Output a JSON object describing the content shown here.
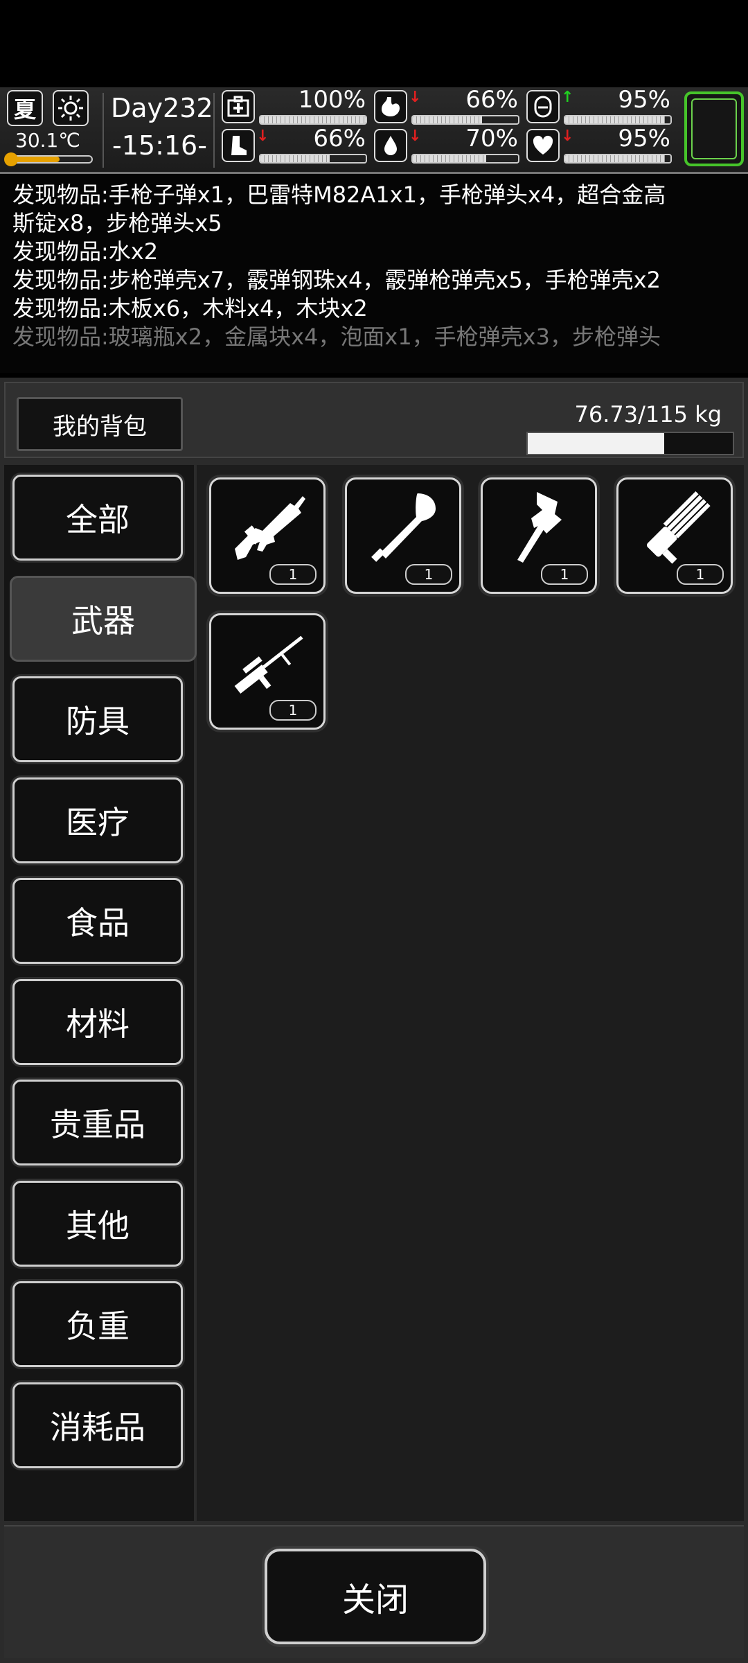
{
  "hud": {
    "season": "夏",
    "temperature": "30.1℃",
    "day": "Day232",
    "time": "-15:16-",
    "stats": [
      {
        "icon": "medkit-icon",
        "value": "100%",
        "fill": 1.0,
        "arrow": "",
        "arrow_color": ""
      },
      {
        "icon": "stomach-icon",
        "value": "66%",
        "fill": 0.66,
        "arrow": "↓",
        "arrow_color": "#e02020"
      },
      {
        "icon": "mood-icon",
        "value": "95%",
        "fill": 0.95,
        "arrow": "↑",
        "arrow_color": "#20d020"
      },
      {
        "icon": "boot-icon",
        "value": "66%",
        "fill": 0.66,
        "arrow": "↓",
        "arrow_color": "#e02020"
      },
      {
        "icon": "water-drop-icon",
        "value": "70%",
        "fill": 0.7,
        "arrow": "↓",
        "arrow_color": "#e02020"
      },
      {
        "icon": "heart-icon",
        "value": "95%",
        "fill": 0.95,
        "arrow": "↓",
        "arrow_color": "#e02020"
      }
    ]
  },
  "log": [
    "发现物品:手枪子弹x1，巴雷特M82A1x1，手枪弹头x4，超合金高",
    "斯锭x8，步枪弹头x5",
    "发现物品:水x2",
    "发现物品:步枪弹壳x7，霰弹钢珠x4，霰弹枪弹壳x5，手枪弹壳x2",
    "发现物品:木板x6，木料x4，木块x2",
    "发现物品:玻璃瓶x2，金属块x4，泡面x1，手枪弹壳x3，步枪弹头"
  ],
  "backpack": {
    "title": "我的背包",
    "weight_text": "76.73/115 kg",
    "weight_fill": 0.667
  },
  "categories": [
    "全部",
    "武器",
    "防具",
    "医疗",
    "食品",
    "材料",
    "贵重品",
    "其他",
    "负重",
    "消耗品"
  ],
  "active_category": "武器",
  "items": [
    {
      "icon": "assault-rifle-icon",
      "count": "1"
    },
    {
      "icon": "shovel-icon",
      "count": "1"
    },
    {
      "icon": "axe-icon",
      "count": "1"
    },
    {
      "icon": "minigun-icon",
      "count": "1"
    },
    {
      "icon": "sniper-rifle-icon",
      "count": "1"
    }
  ],
  "close_label": "关闭",
  "colors": {
    "accent_green": "#46c42a",
    "temp_bar": "#e6a100"
  }
}
